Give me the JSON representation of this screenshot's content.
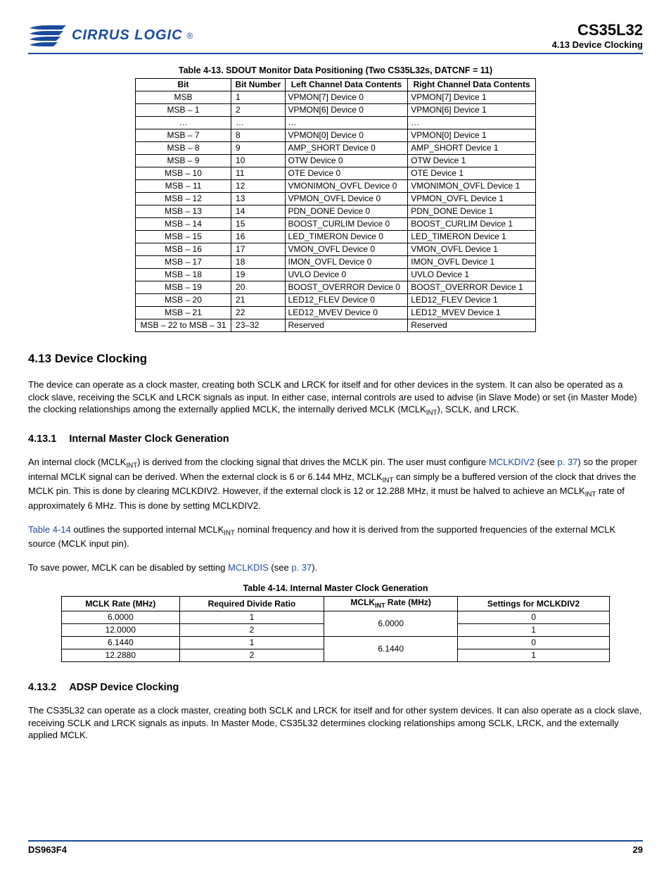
{
  "header": {
    "logo_text": "CIRRUS LOGIC",
    "chip": "CS35L32",
    "section_label": "4.13 Device Clocking"
  },
  "table1": {
    "caption": "Table 4-13.  SDOUT Monitor Data Positioning (Two CS35L32s, DATCNF = 11)",
    "headers": [
      "Bit",
      "Bit Number",
      "Left Channel Data Contents",
      "Right Channel Data Contents"
    ],
    "rows": [
      [
        "MSB",
        "1",
        "VPMON[7] Device 0",
        "VPMON[7] Device 1"
      ],
      [
        "MSB – 1",
        "2",
        "VPMON[6] Device 0",
        "VPMON[6] Device 1"
      ],
      [
        "…",
        "…",
        "…",
        "…"
      ],
      [
        "MSB – 7",
        "8",
        "VPMON[0] Device 0",
        "VPMON[0] Device 1"
      ],
      [
        "MSB – 8",
        "9",
        "AMP_SHORT Device 0",
        "AMP_SHORT Device 1"
      ],
      [
        "MSB – 9",
        "10",
        "OTW Device 0",
        "OTW Device 1"
      ],
      [
        "MSB – 10",
        "11",
        "OTE Device 0",
        "OTE Device 1"
      ],
      [
        "MSB – 11",
        "12",
        "VMONIMON_OVFL Device 0",
        "VMONIMON_OVFL Device 1"
      ],
      [
        "MSB – 12",
        "13",
        "VPMON_OVFL Device 0",
        "VPMON_OVFL Device 1"
      ],
      [
        "MSB – 13",
        "14",
        "PDN_DONE Device 0",
        "PDN_DONE Device 1"
      ],
      [
        "MSB – 14",
        "15",
        "BOOST_CURLIM Device 0",
        "BOOST_CURLIM Device 1"
      ],
      [
        "MSB – 15",
        "16",
        "LED_TIMERON Device 0",
        "LED_TIMERON Device 1"
      ],
      [
        "MSB – 16",
        "17",
        "VMON_OVFL Device 0",
        "VMON_OVFL Device 1"
      ],
      [
        "MSB – 17",
        "18",
        "IMON_OVFL Device 0",
        "IMON_OVFL Device 1"
      ],
      [
        "MSB – 18",
        "19",
        "UVLO Device 0",
        "UVLO Device 1"
      ],
      [
        "MSB – 19",
        "20",
        "BOOST_OVERROR Device 0",
        "BOOST_OVERROR Device 1"
      ],
      [
        "MSB – 20",
        "21",
        "LED12_FLEV Device 0",
        "LED12_FLEV Device 1"
      ],
      [
        "MSB – 21",
        "22",
        "LED12_MVEV Device 0",
        "LED12_MVEV Device 1"
      ],
      [
        "MSB – 22 to MSB – 31",
        "23–32",
        "Reserved",
        "Reserved"
      ]
    ]
  },
  "section": {
    "num": "4.13",
    "title": "Device Clocking",
    "para1_a": "The device can operate as a clock master, creating both SCLK and LRCK for itself and for other devices in the system. It can also be operated as a clock slave, receiving the SCLK and LRCK signals as input. In either case, internal controls are used to advise (in Slave Mode) or set (in Master Mode) the clocking relationships among the externally applied MCLK, the internally derived MCLK (MCLK",
    "para1_b": "), SCLK, and LRCK."
  },
  "sub1": {
    "num": "4.13.1",
    "title": "Internal Master Clock Generation",
    "p1_a": "An internal clock (MCLK",
    "p1_b": ") is derived from the clocking signal that drives the MCLK pin. The user must configure ",
    "p1_link1": "MCLKDIV2",
    "p1_c": " (see ",
    "p1_link2": "p. 37",
    "p1_d": ") so the proper internal MCLK signal can be derived. When the external clock is 6 or 6.144 MHz, MCLK",
    "p1_e": " can simply be a buffered version of the clock that drives the MCLK pin. This is done by clearing MCLKDIV2. However, if the external clock is 12 or 12.288 MHz, it must be halved to achieve an MCLK",
    "p1_f": " rate of approximately 6 MHz. This is done by setting MCLKDIV2.",
    "p2_link": "Table 4-14",
    "p2_a": " outlines the supported internal MCLK",
    "p2_b": " nominal frequency and how it is derived from the supported frequencies of the external MCLK source (MCLK input pin).",
    "p3_a": "To save power, MCLK can be disabled by setting ",
    "p3_link1": "MCLKDIS",
    "p3_b": " (see ",
    "p3_link2": "p. 37",
    "p3_c": ")."
  },
  "table2": {
    "caption": "Table 4-14.  Internal Master Clock Generation",
    "headers_a": "MCLK Rate (MHz)",
    "headers_b": "Required Divide Ratio",
    "headers_c_pre": "MCLK",
    "headers_c_post": " Rate (MHz)",
    "headers_d": "Settings for MCLKDIV2",
    "rows": [
      [
        "6.0000",
        "1",
        "6.0000",
        "0"
      ],
      [
        "12.0000",
        "2",
        "",
        "1"
      ],
      [
        "6.1440",
        "1",
        "6.1440",
        "0"
      ],
      [
        "12.2880",
        "2",
        "",
        "1"
      ]
    ]
  },
  "sub2": {
    "num": "4.13.2",
    "title": "ADSP Device Clocking",
    "p1": "The CS35L32 can operate as a clock master, creating both SCLK and LRCK for itself and for other system devices. It can also operate as a clock slave, receiving SCLK and LRCK signals as inputs. In Master Mode, CS35L32 determines clocking relationships among SCLK, LRCK, and the externally applied MCLK."
  },
  "footer": {
    "left": "DS963F4",
    "right": "29"
  },
  "const": {
    "int_sub": "INT"
  }
}
